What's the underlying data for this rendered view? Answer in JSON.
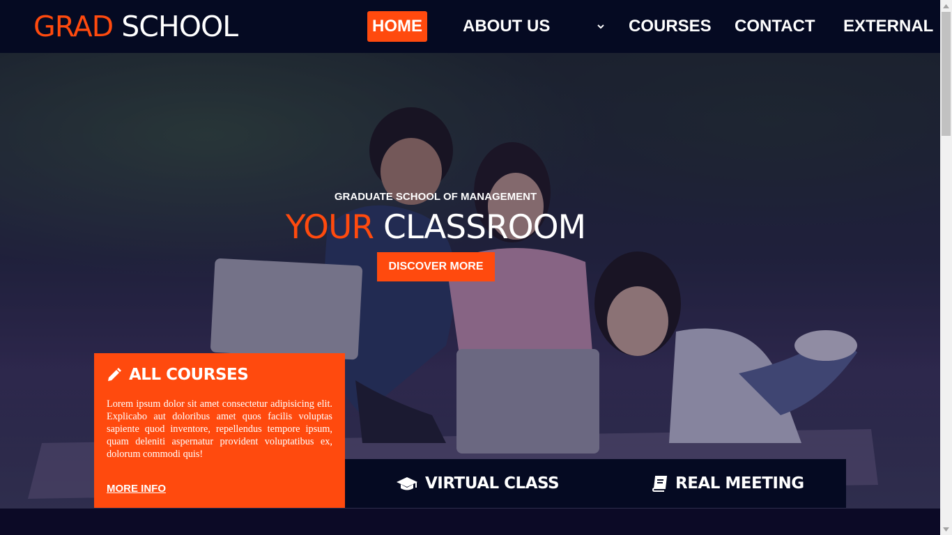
{
  "brand": {
    "word1": "GRAD",
    "word2": "SCHOOL"
  },
  "nav": {
    "home": "HOME",
    "about": "ABOUT US",
    "courses": "COURSES",
    "contact": "CONTACT",
    "external": "EXTERNAL"
  },
  "hero": {
    "subtitle": "GRADUATE SCHOOL OF MANAGEMENT",
    "title_word1": "YOUR",
    "title_word2": "CLASSROOM",
    "cta": "DISCOVER MORE"
  },
  "features": {
    "courses": {
      "title": "ALL COURSES",
      "icon": "pencil-icon",
      "text": "Lorem ipsum dolor sit amet consectetur adipisicing elit. Explicabo aut doloribus amet quos facilis voluptas sapiente quod inventore, repellendus tempore ipsum, quam deleniti aspernatur provident voluptatibus ex, dolorum commodi quis!",
      "link": "MORE INFO"
    },
    "virtual": {
      "title": "VIRTUAL CLASS",
      "icon": "graduation-cap-icon"
    },
    "meeting": {
      "title": "REAL MEETING",
      "icon": "book-icon"
    }
  },
  "colors": {
    "accent": "#ff4a0e",
    "header_bg": "#050a22",
    "page_bg": "#0c0a26"
  }
}
